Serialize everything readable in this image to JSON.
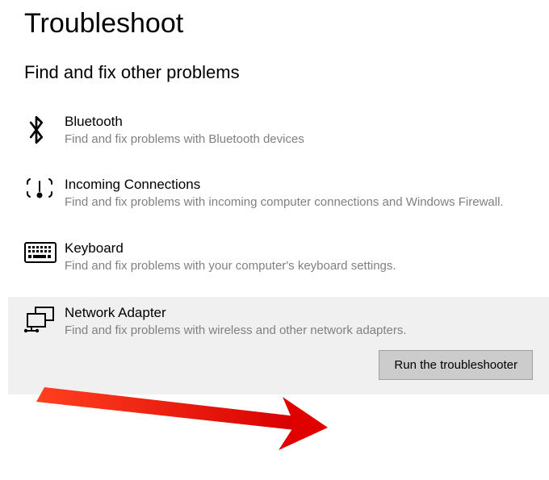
{
  "page": {
    "title": "Troubleshoot",
    "section_title": "Find and fix other problems"
  },
  "items": [
    {
      "icon": "bluetooth-icon",
      "label": "Bluetooth",
      "desc": "Find and fix problems with Bluetooth devices"
    },
    {
      "icon": "incoming-connections-icon",
      "label": "Incoming Connections",
      "desc": "Find and fix problems with incoming computer connections and Windows Firewall."
    },
    {
      "icon": "keyboard-icon",
      "label": "Keyboard",
      "desc": "Find and fix problems with your computer's keyboard settings."
    },
    {
      "icon": "network-adapter-icon",
      "label": "Network Adapter",
      "desc": "Find and fix problems with wireless and other network adapters."
    }
  ],
  "selected_index": 3,
  "button": {
    "run_label": "Run the troubleshooter"
  },
  "annotation": {
    "type": "arrow",
    "color": "#ff1a00"
  }
}
